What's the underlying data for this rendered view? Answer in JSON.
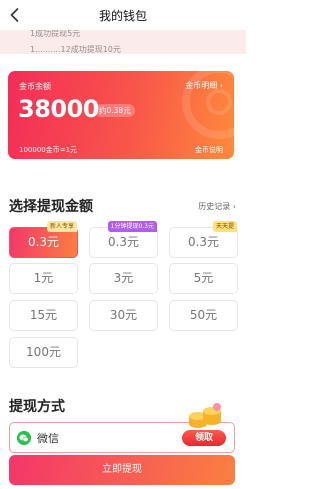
{
  "header": {
    "title": "我的钱包"
  },
  "marquee": {
    "lines": [
      "1成功提现5元",
      "1..........12成功提现10元"
    ]
  },
  "balance_card": {
    "label": "金币余额",
    "detail_link": "金币明细",
    "value": "38000",
    "approx": "约0.38元",
    "rate": "100000金币=1元",
    "explain_link": "金币说明"
  },
  "withdraw": {
    "title": "选择提现金额",
    "history_link": "历史记录",
    "options": [
      {
        "label": "0.3元",
        "tag": "新人专享",
        "selected": true
      },
      {
        "label": "0.3元",
        "tag": "1分钟提现0.3元",
        "selected": false
      },
      {
        "label": "0.3元",
        "tag": "天天提",
        "selected": false
      },
      {
        "label": "1元",
        "tag": "",
        "selected": false
      },
      {
        "label": "3元",
        "tag": "",
        "selected": false
      },
      {
        "label": "5元",
        "tag": "",
        "selected": false
      },
      {
        "label": "15元",
        "tag": "",
        "selected": false
      },
      {
        "label": "30元",
        "tag": "",
        "selected": false
      },
      {
        "label": "50元",
        "tag": "",
        "selected": false
      },
      {
        "label": "100元",
        "tag": "",
        "selected": false
      }
    ]
  },
  "method": {
    "title": "提现方式",
    "wechat_label": "微信"
  },
  "gift": {
    "button": "领取"
  },
  "submit": {
    "label": "立即提现"
  },
  "colors": {
    "accent_start": "#f4366a",
    "accent_end": "#fb8040",
    "wechat": "#29c24c"
  }
}
